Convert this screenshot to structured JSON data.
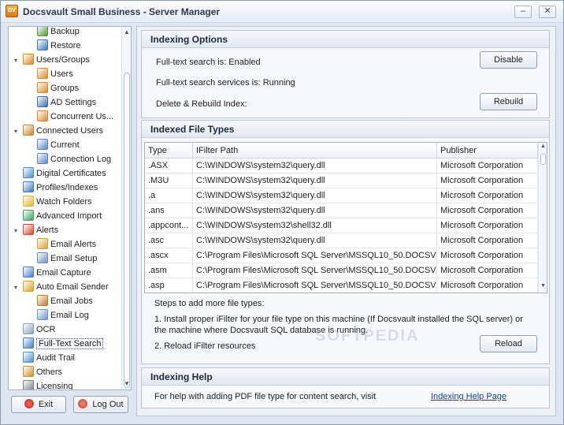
{
  "window": {
    "title": "Docsvault Small Business - Server Manager",
    "app_icon_text": "DV",
    "minimize": "–",
    "maximize": "□",
    "close": "✕"
  },
  "tree": {
    "items": [
      {
        "label": "Backup",
        "icon": "backup-icon",
        "toggle": ""
      },
      {
        "label": "Restore",
        "icon": "restore-icon",
        "toggle": ""
      },
      {
        "label": "Users/Groups",
        "icon": "users-icon",
        "toggle": "▾"
      },
      {
        "label": "Users",
        "icon": "user-icon",
        "toggle": ""
      },
      {
        "label": "Groups",
        "icon": "groups-icon",
        "toggle": ""
      },
      {
        "label": "AD Settings",
        "icon": "ad-settings-icon",
        "toggle": ""
      },
      {
        "label": "Concurrent Us...",
        "icon": "concurrent-users-icon",
        "toggle": ""
      },
      {
        "label": "Connected Users",
        "icon": "connected-users-icon",
        "toggle": "▾"
      },
      {
        "label": "Current",
        "icon": "current-icon",
        "toggle": ""
      },
      {
        "label": "Connection Log",
        "icon": "connection-log-icon",
        "toggle": ""
      },
      {
        "label": "Digital Certificates",
        "icon": "certificate-icon",
        "toggle": ""
      },
      {
        "label": "Profiles/Indexes",
        "icon": "profiles-icon",
        "toggle": ""
      },
      {
        "label": "Watch Folders",
        "icon": "folder-icon",
        "toggle": ""
      },
      {
        "label": "Advanced Import",
        "icon": "import-icon",
        "toggle": ""
      },
      {
        "label": "Alerts",
        "icon": "alert-icon",
        "toggle": "▾"
      },
      {
        "label": "Email Alerts",
        "icon": "email-alerts-icon",
        "toggle": ""
      },
      {
        "label": "Email Setup",
        "icon": "email-setup-icon",
        "toggle": ""
      },
      {
        "label": "Email Capture",
        "icon": "email-capture-icon",
        "toggle": ""
      },
      {
        "label": "Auto Email Sender",
        "icon": "auto-email-icon",
        "toggle": "▾"
      },
      {
        "label": "Email Jobs",
        "icon": "email-jobs-icon",
        "toggle": ""
      },
      {
        "label": "Email Log",
        "icon": "email-log-icon",
        "toggle": ""
      },
      {
        "label": "OCR",
        "icon": "ocr-icon",
        "toggle": ""
      },
      {
        "label": "Full-Text Search",
        "icon": "search-icon",
        "toggle": ""
      },
      {
        "label": "Audit Trail",
        "icon": "audit-icon",
        "toggle": ""
      },
      {
        "label": "Others",
        "icon": "others-icon",
        "toggle": ""
      },
      {
        "label": "Licensing",
        "icon": "licensing-icon",
        "toggle": ""
      }
    ],
    "selected": "Full-Text Search"
  },
  "footer": {
    "exit_label": "Exit",
    "logout_label": "Log Out"
  },
  "indexing_options": {
    "header": "Indexing Options",
    "fulltext_status": "Full-text search is:  Enabled",
    "services_status": "Full-text search services is:  Running",
    "rebuild_label": "Delete & Rebuild Index:",
    "disable_button": "Disable",
    "rebuild_button": "Rebuild"
  },
  "file_types": {
    "header": "Indexed File Types",
    "columns": [
      "Type",
      "IFilter Path",
      "Publisher"
    ],
    "rows": [
      [
        ".ASX",
        "C:\\WINDOWS\\system32\\query.dll",
        "Microsoft Corporation"
      ],
      [
        ".M3U",
        "C:\\WINDOWS\\system32\\query.dll",
        "Microsoft Corporation"
      ],
      [
        ".a",
        "C:\\WINDOWS\\system32\\query.dll",
        "Microsoft Corporation"
      ],
      [
        ".ans",
        "C:\\WINDOWS\\system32\\query.dll",
        "Microsoft Corporation"
      ],
      [
        ".appcont...",
        "C:\\WINDOWS\\system32\\shell32.dll",
        "Microsoft Corporation"
      ],
      [
        ".asc",
        "C:\\WINDOWS\\system32\\query.dll",
        "Microsoft Corporation"
      ],
      [
        ".ascx",
        "C:\\Program Files\\Microsoft SQL Server\\MSSQL10_50.DOCSV...",
        "Microsoft Corporation"
      ],
      [
        ".asm",
        "C:\\Program Files\\Microsoft SQL Server\\MSSQL10_50.DOCSV...",
        "Microsoft Corporation"
      ],
      [
        ".asp",
        "C:\\Program Files\\Microsoft SQL Server\\MSSQL10_50.DOCSV...",
        "Microsoft Corporation"
      ]
    ],
    "steps_title": "Steps to add more file types:",
    "step1": "1. Install proper iFilter for your file type on this machine (If Docsvault installed the SQL server) or",
    "step1b": "the machine where Docsvault SQL database is running.",
    "step2": "2. Reload iFilter resources",
    "reload_button": "Reload"
  },
  "indexing_help": {
    "header": "Indexing Help",
    "text": "For help with adding PDF file type for content search, visit",
    "link": "Indexing Help Page"
  },
  "watermark": "SOFTPEDIA",
  "colors": {
    "accent": "#3a5a8c",
    "link": "#0645ad",
    "panel": "#eef2f7"
  }
}
